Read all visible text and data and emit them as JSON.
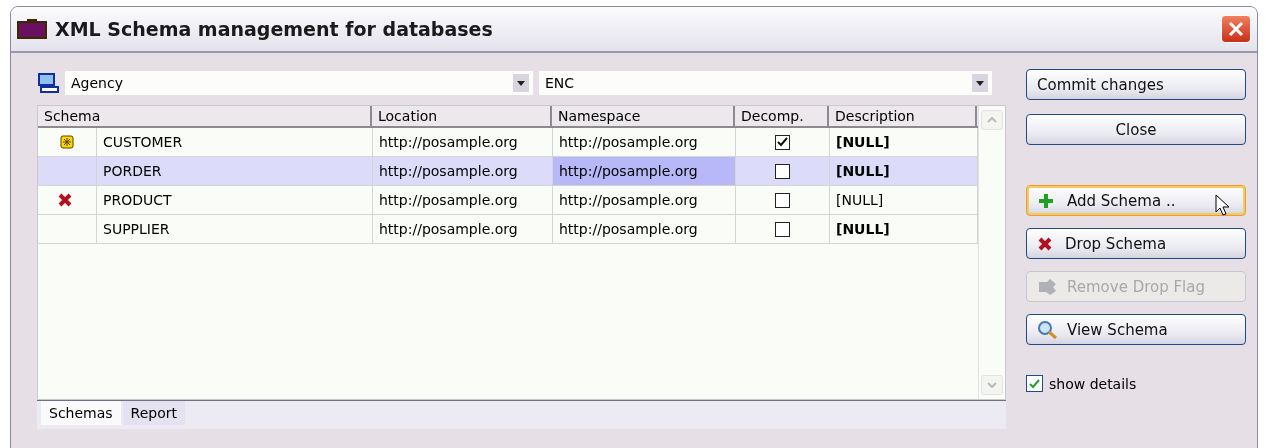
{
  "window": {
    "title": "XML Schema management for databases"
  },
  "database_combo": {
    "value": "Agency"
  },
  "schema_combo": {
    "value": "ENC"
  },
  "table": {
    "columns": [
      "Schema",
      "Location",
      "Namespace",
      "Decomp.",
      "Description"
    ],
    "rows": [
      {
        "kind": "new",
        "name": "CUSTOMER",
        "location": "http://posample.org",
        "namespace": "http://posample.org",
        "decomp": true,
        "description": "[NULL]",
        "bold": true,
        "selected": false
      },
      {
        "kind": "plain",
        "name": "PORDER",
        "location": "http://posample.org",
        "namespace": "http://posample.org",
        "decomp": false,
        "description": "[NULL]",
        "bold": true,
        "selected": true
      },
      {
        "kind": "drop",
        "name": "PRODUCT",
        "location": "http://posample.org",
        "namespace": "http://posample.org",
        "decomp": false,
        "description": "[NULL]",
        "bold": false,
        "selected": false
      },
      {
        "kind": "plain",
        "name": "SUPPLIER",
        "location": "http://posample.org",
        "namespace": "http://posample.org",
        "decomp": false,
        "description": "[NULL]",
        "bold": true,
        "selected": false
      }
    ]
  },
  "tabs": [
    {
      "label": "Schemas",
      "selected": true
    },
    {
      "label": "Report",
      "selected": false
    }
  ],
  "top_buttons": [
    {
      "label": "Commit changes",
      "kind": "commit"
    },
    {
      "label": "Close",
      "kind": "close"
    }
  ],
  "action_buttons": [
    {
      "kind": "add",
      "label": "Add Schema ..",
      "disabled": false,
      "focused": true
    },
    {
      "kind": "drop",
      "label": "Drop Schema",
      "disabled": false,
      "focused": false
    },
    {
      "kind": "restore",
      "label": "Remove Drop Flag",
      "disabled": true,
      "focused": false
    },
    {
      "kind": "view",
      "label": "View Schema",
      "disabled": false,
      "focused": false
    }
  ],
  "show_details": {
    "label": "show details",
    "checked": true
  }
}
